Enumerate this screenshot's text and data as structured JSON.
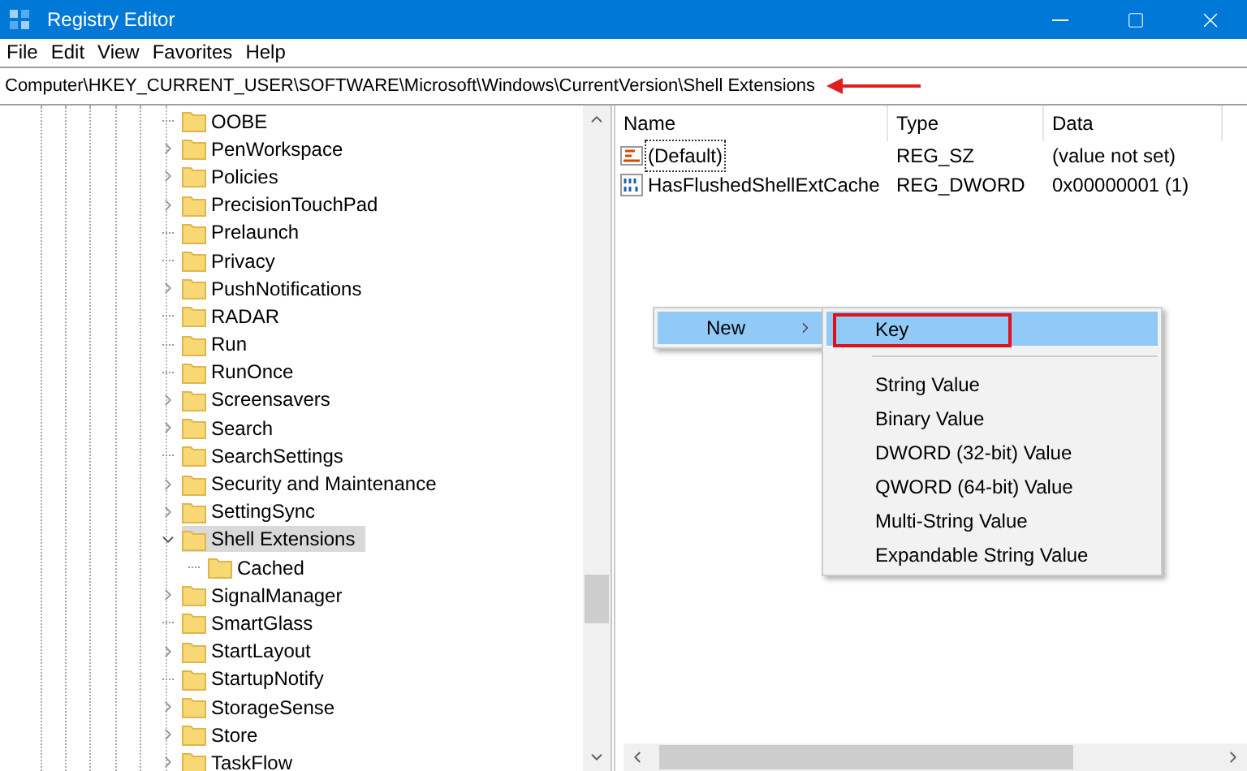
{
  "window": {
    "title": "Registry Editor"
  },
  "menu": [
    "File",
    "Edit",
    "View",
    "Favorites",
    "Help"
  ],
  "address": "Computer\\HKEY_CURRENT_USER\\SOFTWARE\\Microsoft\\Windows\\CurrentVersion\\Shell Extensions",
  "tree": [
    {
      "label": "OOBE",
      "expandable": false,
      "selected": false
    },
    {
      "label": "PenWorkspace",
      "expandable": true,
      "selected": false
    },
    {
      "label": "Policies",
      "expandable": true,
      "selected": false
    },
    {
      "label": "PrecisionTouchPad",
      "expandable": true,
      "selected": false
    },
    {
      "label": "Prelaunch",
      "expandable": false,
      "selected": false
    },
    {
      "label": "Privacy",
      "expandable": false,
      "selected": false
    },
    {
      "label": "PushNotifications",
      "expandable": true,
      "selected": false
    },
    {
      "label": "RADAR",
      "expandable": false,
      "selected": false
    },
    {
      "label": "Run",
      "expandable": false,
      "selected": false
    },
    {
      "label": "RunOnce",
      "expandable": false,
      "selected": false
    },
    {
      "label": "Screensavers",
      "expandable": true,
      "selected": false
    },
    {
      "label": "Search",
      "expandable": true,
      "selected": false
    },
    {
      "label": "SearchSettings",
      "expandable": false,
      "selected": false
    },
    {
      "label": "Security and Maintenance",
      "expandable": true,
      "selected": false
    },
    {
      "label": "SettingSync",
      "expandable": true,
      "selected": false
    },
    {
      "label": "Shell Extensions",
      "expandable": true,
      "selected": true,
      "children": [
        {
          "label": "Cached",
          "expandable": false,
          "selected": false
        }
      ]
    },
    {
      "label": "SignalManager",
      "expandable": true,
      "selected": false
    },
    {
      "label": "SmartGlass",
      "expandable": false,
      "selected": false
    },
    {
      "label": "StartLayout",
      "expandable": true,
      "selected": false
    },
    {
      "label": "StartupNotify",
      "expandable": false,
      "selected": false
    },
    {
      "label": "StorageSense",
      "expandable": true,
      "selected": false
    },
    {
      "label": "Store",
      "expandable": true,
      "selected": false
    },
    {
      "label": "TaskFlow",
      "expandable": true,
      "selected": false
    }
  ],
  "values": {
    "columns": [
      "Name",
      "Type",
      "Data"
    ],
    "rows": [
      {
        "kind": "string",
        "name": "(Default)",
        "type": "REG_SZ",
        "data": "(value not set)",
        "focused": true
      },
      {
        "kind": "binary",
        "name": "HasFlushedShellExtCache",
        "type": "REG_DWORD",
        "data": "0x00000001 (1)",
        "focused": false
      }
    ]
  },
  "context_menu": {
    "items": [
      {
        "label": "New",
        "selected": true
      }
    ]
  },
  "submenu": {
    "items": [
      {
        "label": "Key",
        "selected": true
      },
      {
        "label": "String Value",
        "selected": false
      },
      {
        "label": "Binary Value",
        "selected": false
      },
      {
        "label": "DWORD (32-bit) Value",
        "selected": false
      },
      {
        "label": "QWORD (64-bit) Value",
        "selected": false
      },
      {
        "label": "Multi-String Value",
        "selected": false
      },
      {
        "label": "Expandable String Value",
        "selected": false
      }
    ]
  }
}
